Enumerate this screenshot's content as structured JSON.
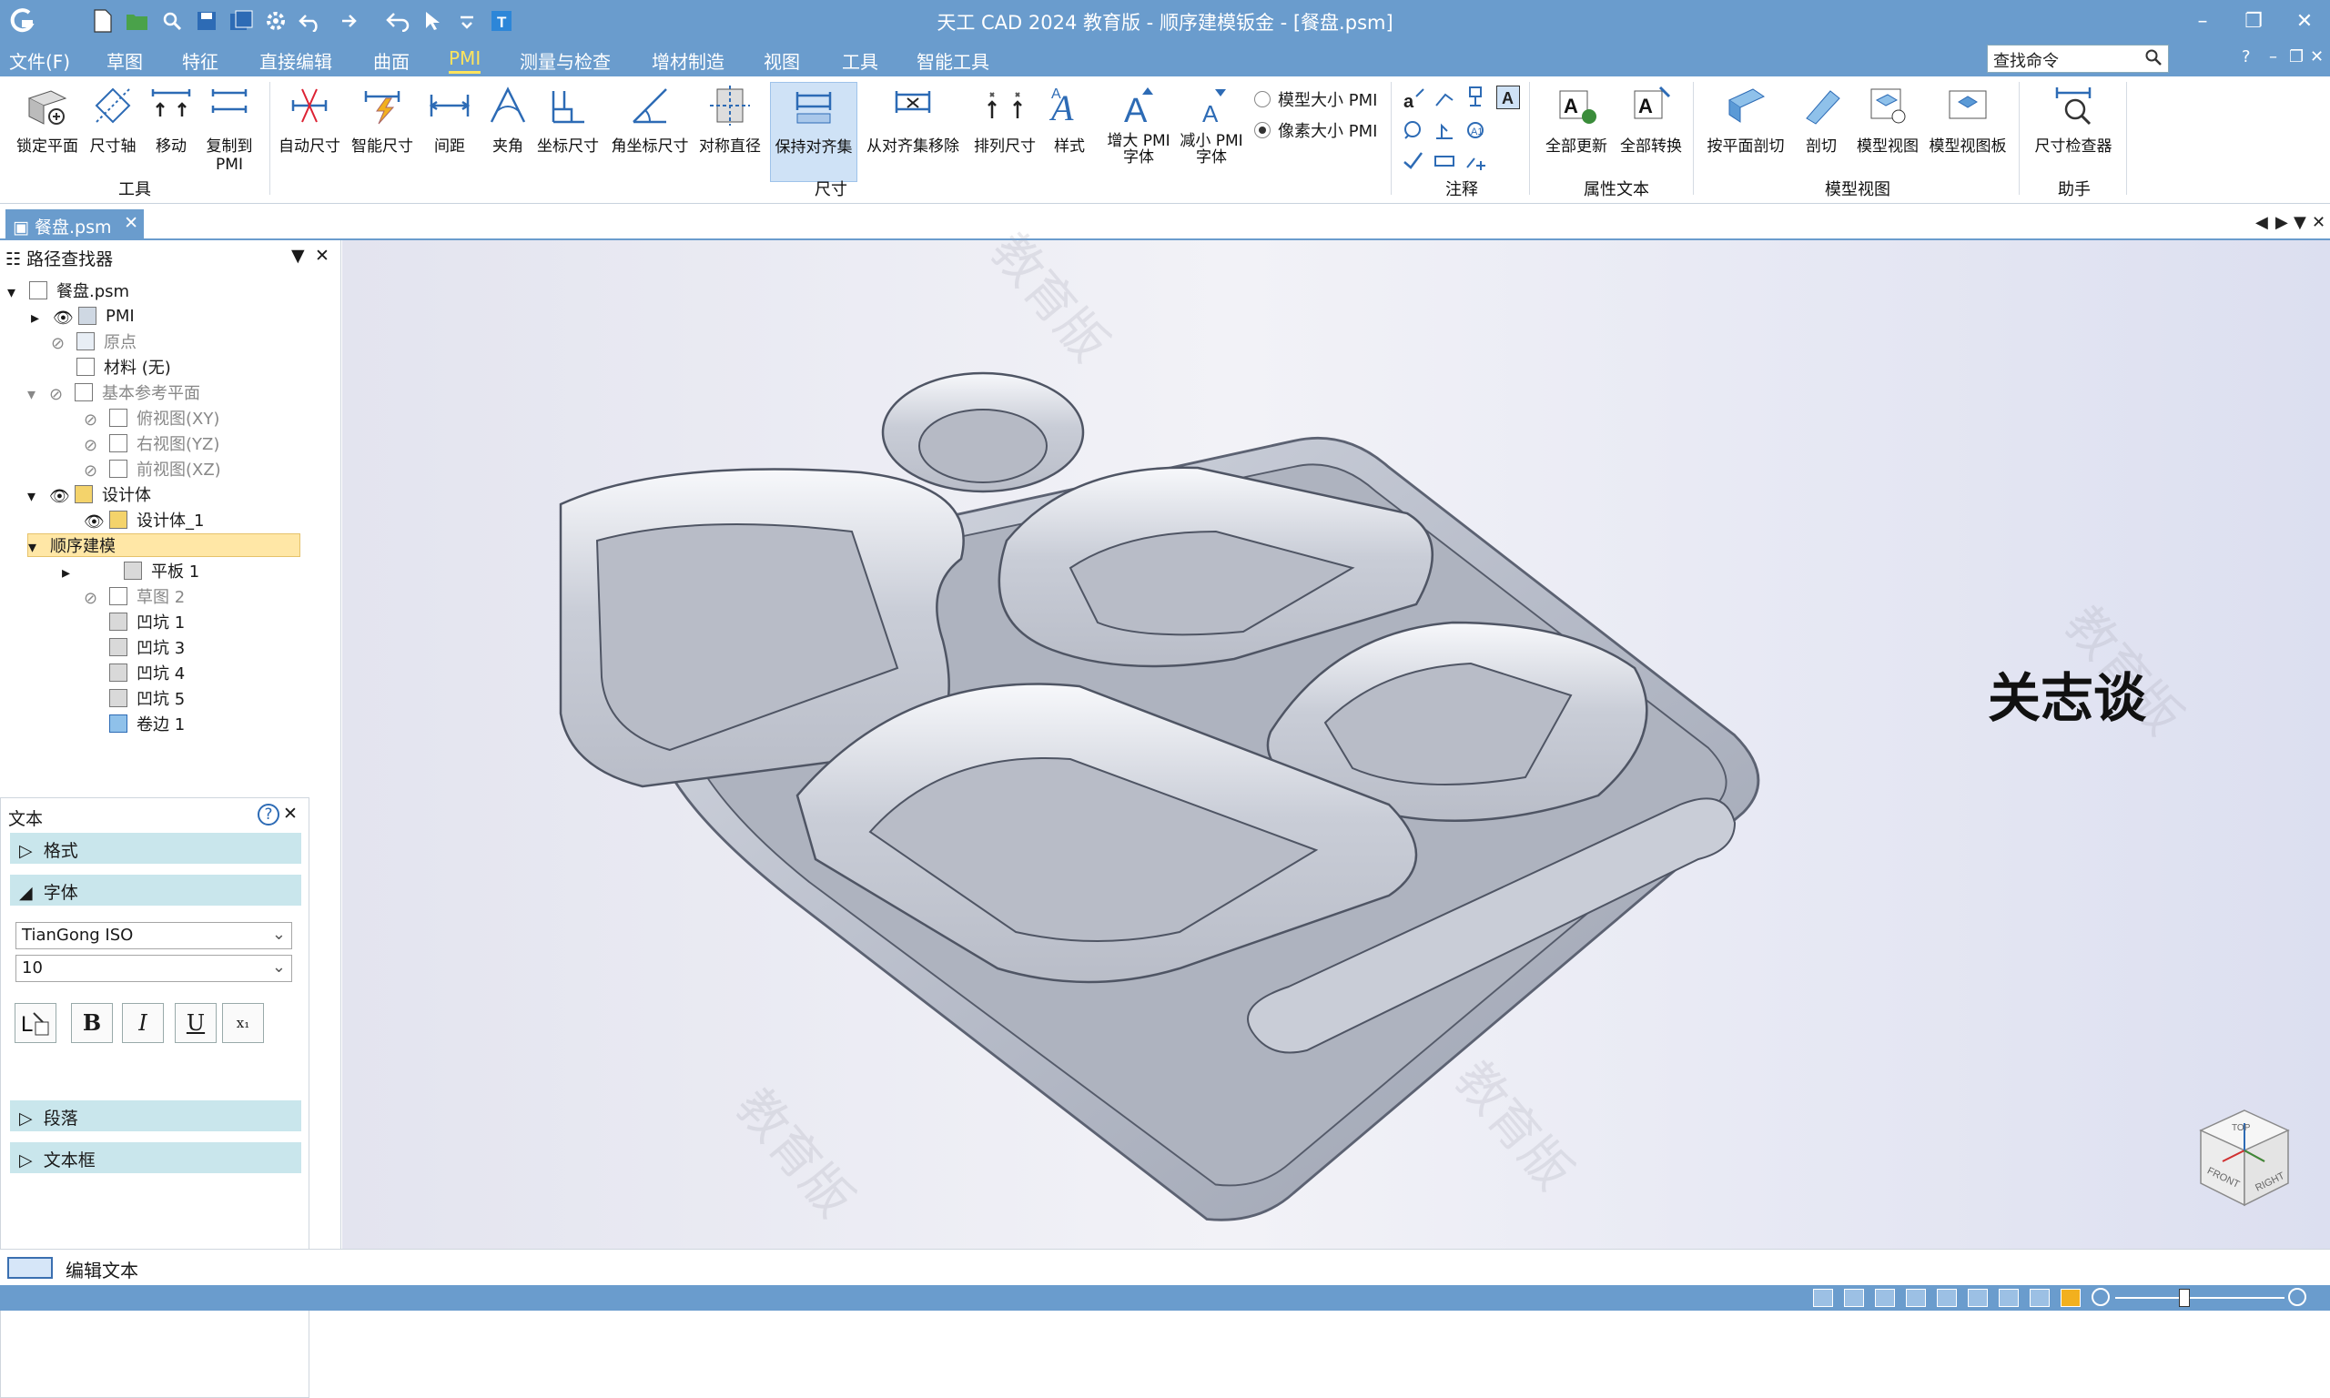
{
  "window": {
    "title": "天工 CAD 2024 教育版 - 顺序建模钣金 - [餐盘.psm]"
  },
  "menu": {
    "items": [
      "文件(F)",
      "草图",
      "特征",
      "直接编辑",
      "曲面",
      "PMI",
      "测量与检查",
      "增材制造",
      "视图",
      "工具",
      "智能工具"
    ],
    "active": "PMI",
    "search_placeholder": "查找命令",
    "help": "?"
  },
  "ribbon": {
    "buttons": [
      {
        "label": "锁定平面"
      },
      {
        "label": "尺寸轴"
      },
      {
        "label": "移动"
      },
      {
        "label": "复制到\nPMI"
      },
      {
        "label": "自动尺寸"
      },
      {
        "label": "智能尺寸"
      },
      {
        "label": "间距"
      },
      {
        "label": "夹角"
      },
      {
        "label": "坐标尺寸"
      },
      {
        "label": "角坐标尺寸"
      },
      {
        "label": "对称直径"
      },
      {
        "label": "保持对齐集"
      },
      {
        "label": "从对齐集移除"
      },
      {
        "label": "排列尺寸"
      },
      {
        "label": "样式"
      },
      {
        "label": "增大 PMI\n字体"
      },
      {
        "label": "减小 PMI\n字体"
      },
      {
        "label": "全部更新"
      },
      {
        "label": "全部转换"
      },
      {
        "label": "按平面剖切"
      },
      {
        "label": "剖切"
      },
      {
        "label": "模型视图"
      },
      {
        "label": "模型视图板"
      },
      {
        "label": "尺寸检查器"
      }
    ],
    "groups": [
      "工具",
      "尺寸",
      "注释",
      "属性文本",
      "模型视图",
      "助手"
    ],
    "radio": [
      {
        "label": "模型大小 PMI",
        "selected": false
      },
      {
        "label": "像素大小 PMI",
        "selected": true
      }
    ]
  },
  "tabs": {
    "doc": "餐盘.psm"
  },
  "pathfinder": {
    "title": "路径查找器",
    "nodes": [
      {
        "label": "餐盘.psm"
      },
      {
        "label": "PMI"
      },
      {
        "label": "原点"
      },
      {
        "label": "材料 (无)"
      },
      {
        "label": "基本参考平面"
      },
      {
        "label": "俯视图(XY)"
      },
      {
        "label": "右视图(YZ)"
      },
      {
        "label": "前视图(XZ)"
      },
      {
        "label": "设计体"
      },
      {
        "label": "设计体_1"
      },
      {
        "label": "顺序建模"
      },
      {
        "label": "平板 1"
      },
      {
        "label": "草图 2"
      },
      {
        "label": "凹坑 1"
      },
      {
        "label": "凹坑 3"
      },
      {
        "label": "凹坑 4"
      },
      {
        "label": "凹坑 5"
      },
      {
        "label": "卷边 1"
      }
    ]
  },
  "text_panel": {
    "title": "文本",
    "sections": [
      "格式",
      "字体",
      "段落",
      "文本框"
    ],
    "font": "TianGong ISO",
    "size": "10"
  },
  "viewport": {
    "annotation": "关志谈",
    "watermark": "教育版",
    "viewcube": {
      "top": "TOP",
      "front": "FRONT",
      "right": "RIGHT"
    }
  },
  "command_bar": {
    "text": "编辑文本"
  },
  "colors": {
    "chrome": "#6a9ccd",
    "active_menu": "#ffe45c",
    "section_bg": "#c9e6ec",
    "highlight": "#ffe7a6"
  }
}
